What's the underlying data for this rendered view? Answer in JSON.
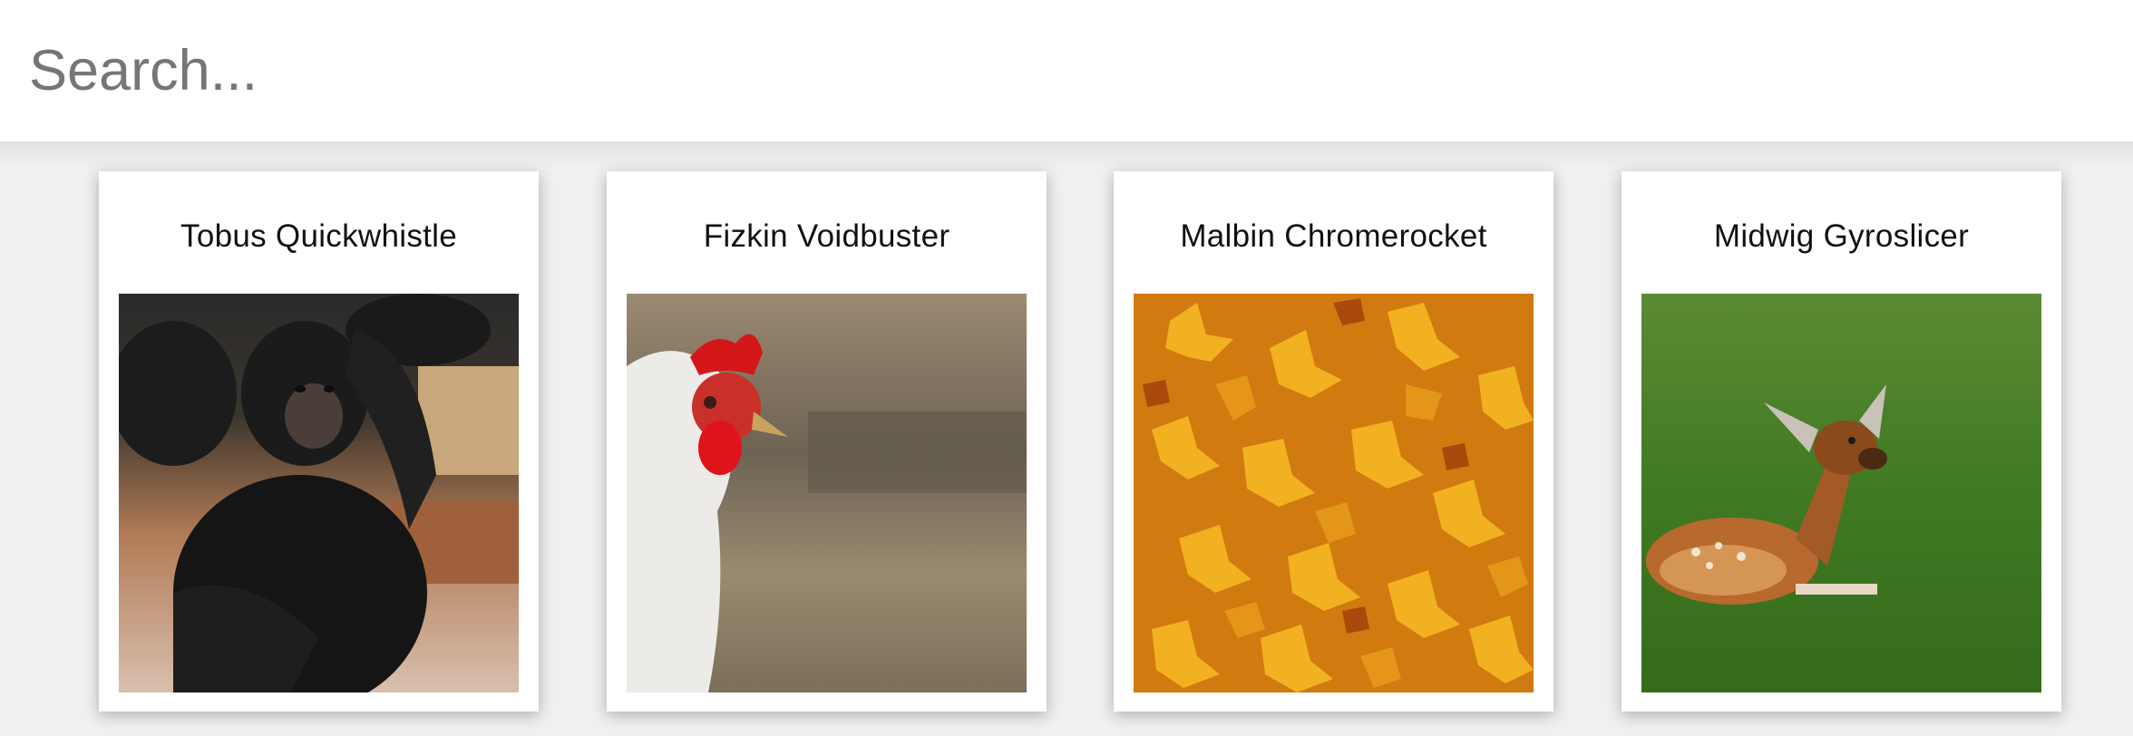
{
  "search": {
    "placeholder": "Search..."
  },
  "cards": [
    {
      "title": "Tobus Quickwhistle",
      "image": "chimpanzee-photo"
    },
    {
      "title": "Fizkin Voidbuster",
      "image": "white-chicken-photo"
    },
    {
      "title": "Malbin Chromerocket",
      "image": "autumn-maple-leaves-photo"
    },
    {
      "title": "Midwig Gyroslicer",
      "image": "fawn-in-grass-photo"
    }
  ]
}
